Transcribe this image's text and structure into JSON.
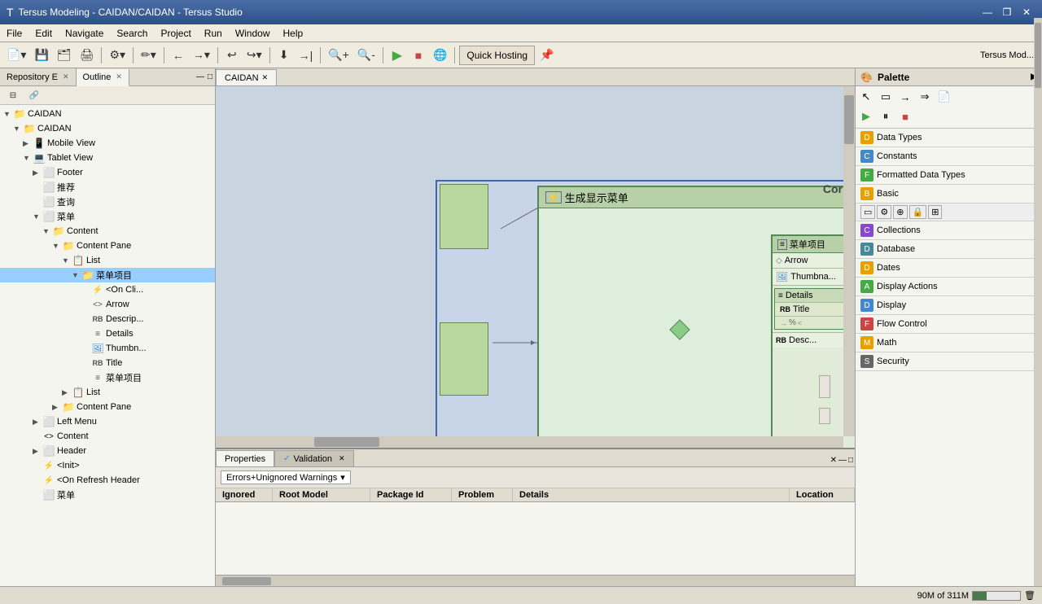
{
  "titlebar": {
    "icon": "T",
    "title": "Tersus Modeling - CAIDAN/CAIDAN - Tersus Studio",
    "minimize": "—",
    "maximize": "❐",
    "close": "✕"
  },
  "menubar": {
    "items": [
      "File",
      "Edit",
      "Navigate",
      "Search",
      "Project",
      "Run",
      "Window",
      "Help"
    ]
  },
  "toolbar": {
    "hosting_label": "Quick Hosting"
  },
  "left_panel": {
    "tabs": [
      {
        "label": "Repository E",
        "active": false
      },
      {
        "label": "Outline",
        "active": true
      }
    ],
    "tree": [
      {
        "level": 0,
        "label": "CAIDAN",
        "icon": "📁",
        "expanded": true
      },
      {
        "level": 1,
        "label": "CAIDAN",
        "icon": "📁",
        "expanded": true
      },
      {
        "level": 2,
        "label": "Mobile View",
        "icon": "📱",
        "expanded": false
      },
      {
        "level": 2,
        "label": "Tablet View",
        "icon": "💻",
        "expanded": true
      },
      {
        "level": 3,
        "label": "Footer",
        "icon": "⬜",
        "expanded": false
      },
      {
        "level": 3,
        "label": "推荐",
        "icon": "⬜",
        "expanded": false
      },
      {
        "level": 3,
        "label": "查询",
        "icon": "⬜",
        "expanded": false
      },
      {
        "level": 3,
        "label": "菜单",
        "icon": "⬜",
        "expanded": true
      },
      {
        "level": 4,
        "label": "Content",
        "icon": "📁",
        "expanded": true
      },
      {
        "level": 5,
        "label": "Content Pane",
        "icon": "📁",
        "expanded": true
      },
      {
        "level": 6,
        "label": "List",
        "icon": "📋",
        "expanded": true
      },
      {
        "level": 7,
        "label": "菜单项目",
        "icon": "📁",
        "expanded": true
      },
      {
        "level": 8,
        "label": "<On Cli...",
        "icon": "⚡",
        "expanded": false
      },
      {
        "level": 8,
        "label": "Arrow",
        "icon": "<>",
        "expanded": false
      },
      {
        "level": 8,
        "label": "Descrip...",
        "icon": "RB",
        "expanded": false
      },
      {
        "level": 8,
        "label": "Details",
        "icon": "≡",
        "expanded": false
      },
      {
        "level": 8,
        "label": "Thumbn...",
        "icon": "🖼",
        "expanded": false
      },
      {
        "level": 8,
        "label": "Title",
        "icon": "RB",
        "expanded": false
      },
      {
        "level": 8,
        "label": "菜单项目",
        "icon": "≡",
        "expanded": false
      },
      {
        "level": 6,
        "label": "List",
        "icon": "📋",
        "expanded": false
      },
      {
        "level": 5,
        "label": "Content Pane",
        "icon": "📁",
        "expanded": false
      },
      {
        "level": 3,
        "label": "Left Menu",
        "icon": "⬜",
        "expanded": false
      },
      {
        "level": 3,
        "label": "Content",
        "icon": "<>",
        "expanded": false
      },
      {
        "level": 3,
        "label": "Header",
        "icon": "⬜",
        "expanded": false
      },
      {
        "level": 3,
        "label": "<Init>",
        "icon": "⚡",
        "expanded": false
      },
      {
        "level": 3,
        "label": "<On Refresh Header",
        "icon": "⚡",
        "expanded": false
      },
      {
        "level": 3,
        "label": "菜单",
        "icon": "⬜",
        "expanded": false
      }
    ]
  },
  "editor": {
    "tabs": [
      {
        "label": "CAIDAN",
        "active": true
      }
    ]
  },
  "diagram": {
    "outer_title": "生成显示菜单",
    "inner_title": "菜单项目",
    "rows": [
      {
        "icon": "◇",
        "label": "Arrow"
      },
      {
        "icon": "🖼",
        "label": "Thumbnail"
      },
      {
        "icon": "≡",
        "label": "Details",
        "sub": true
      },
      {
        "sub_label": "Title"
      },
      {
        "sub_label2": "%"
      },
      {
        "icon": "RB",
        "label": "Desc..."
      }
    ],
    "cor_label": "Cor"
  },
  "palette": {
    "title": "Palette",
    "categories": [
      {
        "label": "Data Types"
      },
      {
        "label": "Constants"
      },
      {
        "label": "Formatted Data Types"
      },
      {
        "label": "Basic"
      },
      {
        "label": "Collections"
      },
      {
        "label": "Database"
      },
      {
        "label": "Dates"
      },
      {
        "label": "Display Actions"
      },
      {
        "label": "Display"
      },
      {
        "label": "Flow Control"
      },
      {
        "label": "Math"
      },
      {
        "label": "Security"
      }
    ]
  },
  "bottom": {
    "tabs": [
      {
        "label": "Properties",
        "active": true
      },
      {
        "label": "Validation",
        "active": false
      }
    ],
    "filter": "Errors+Unignored Warnings",
    "columns": [
      "Ignored",
      "Root Model",
      "Package Id",
      "Problem",
      "Details",
      "Location"
    ]
  },
  "statusbar": {
    "memory": "90M of 311M"
  }
}
